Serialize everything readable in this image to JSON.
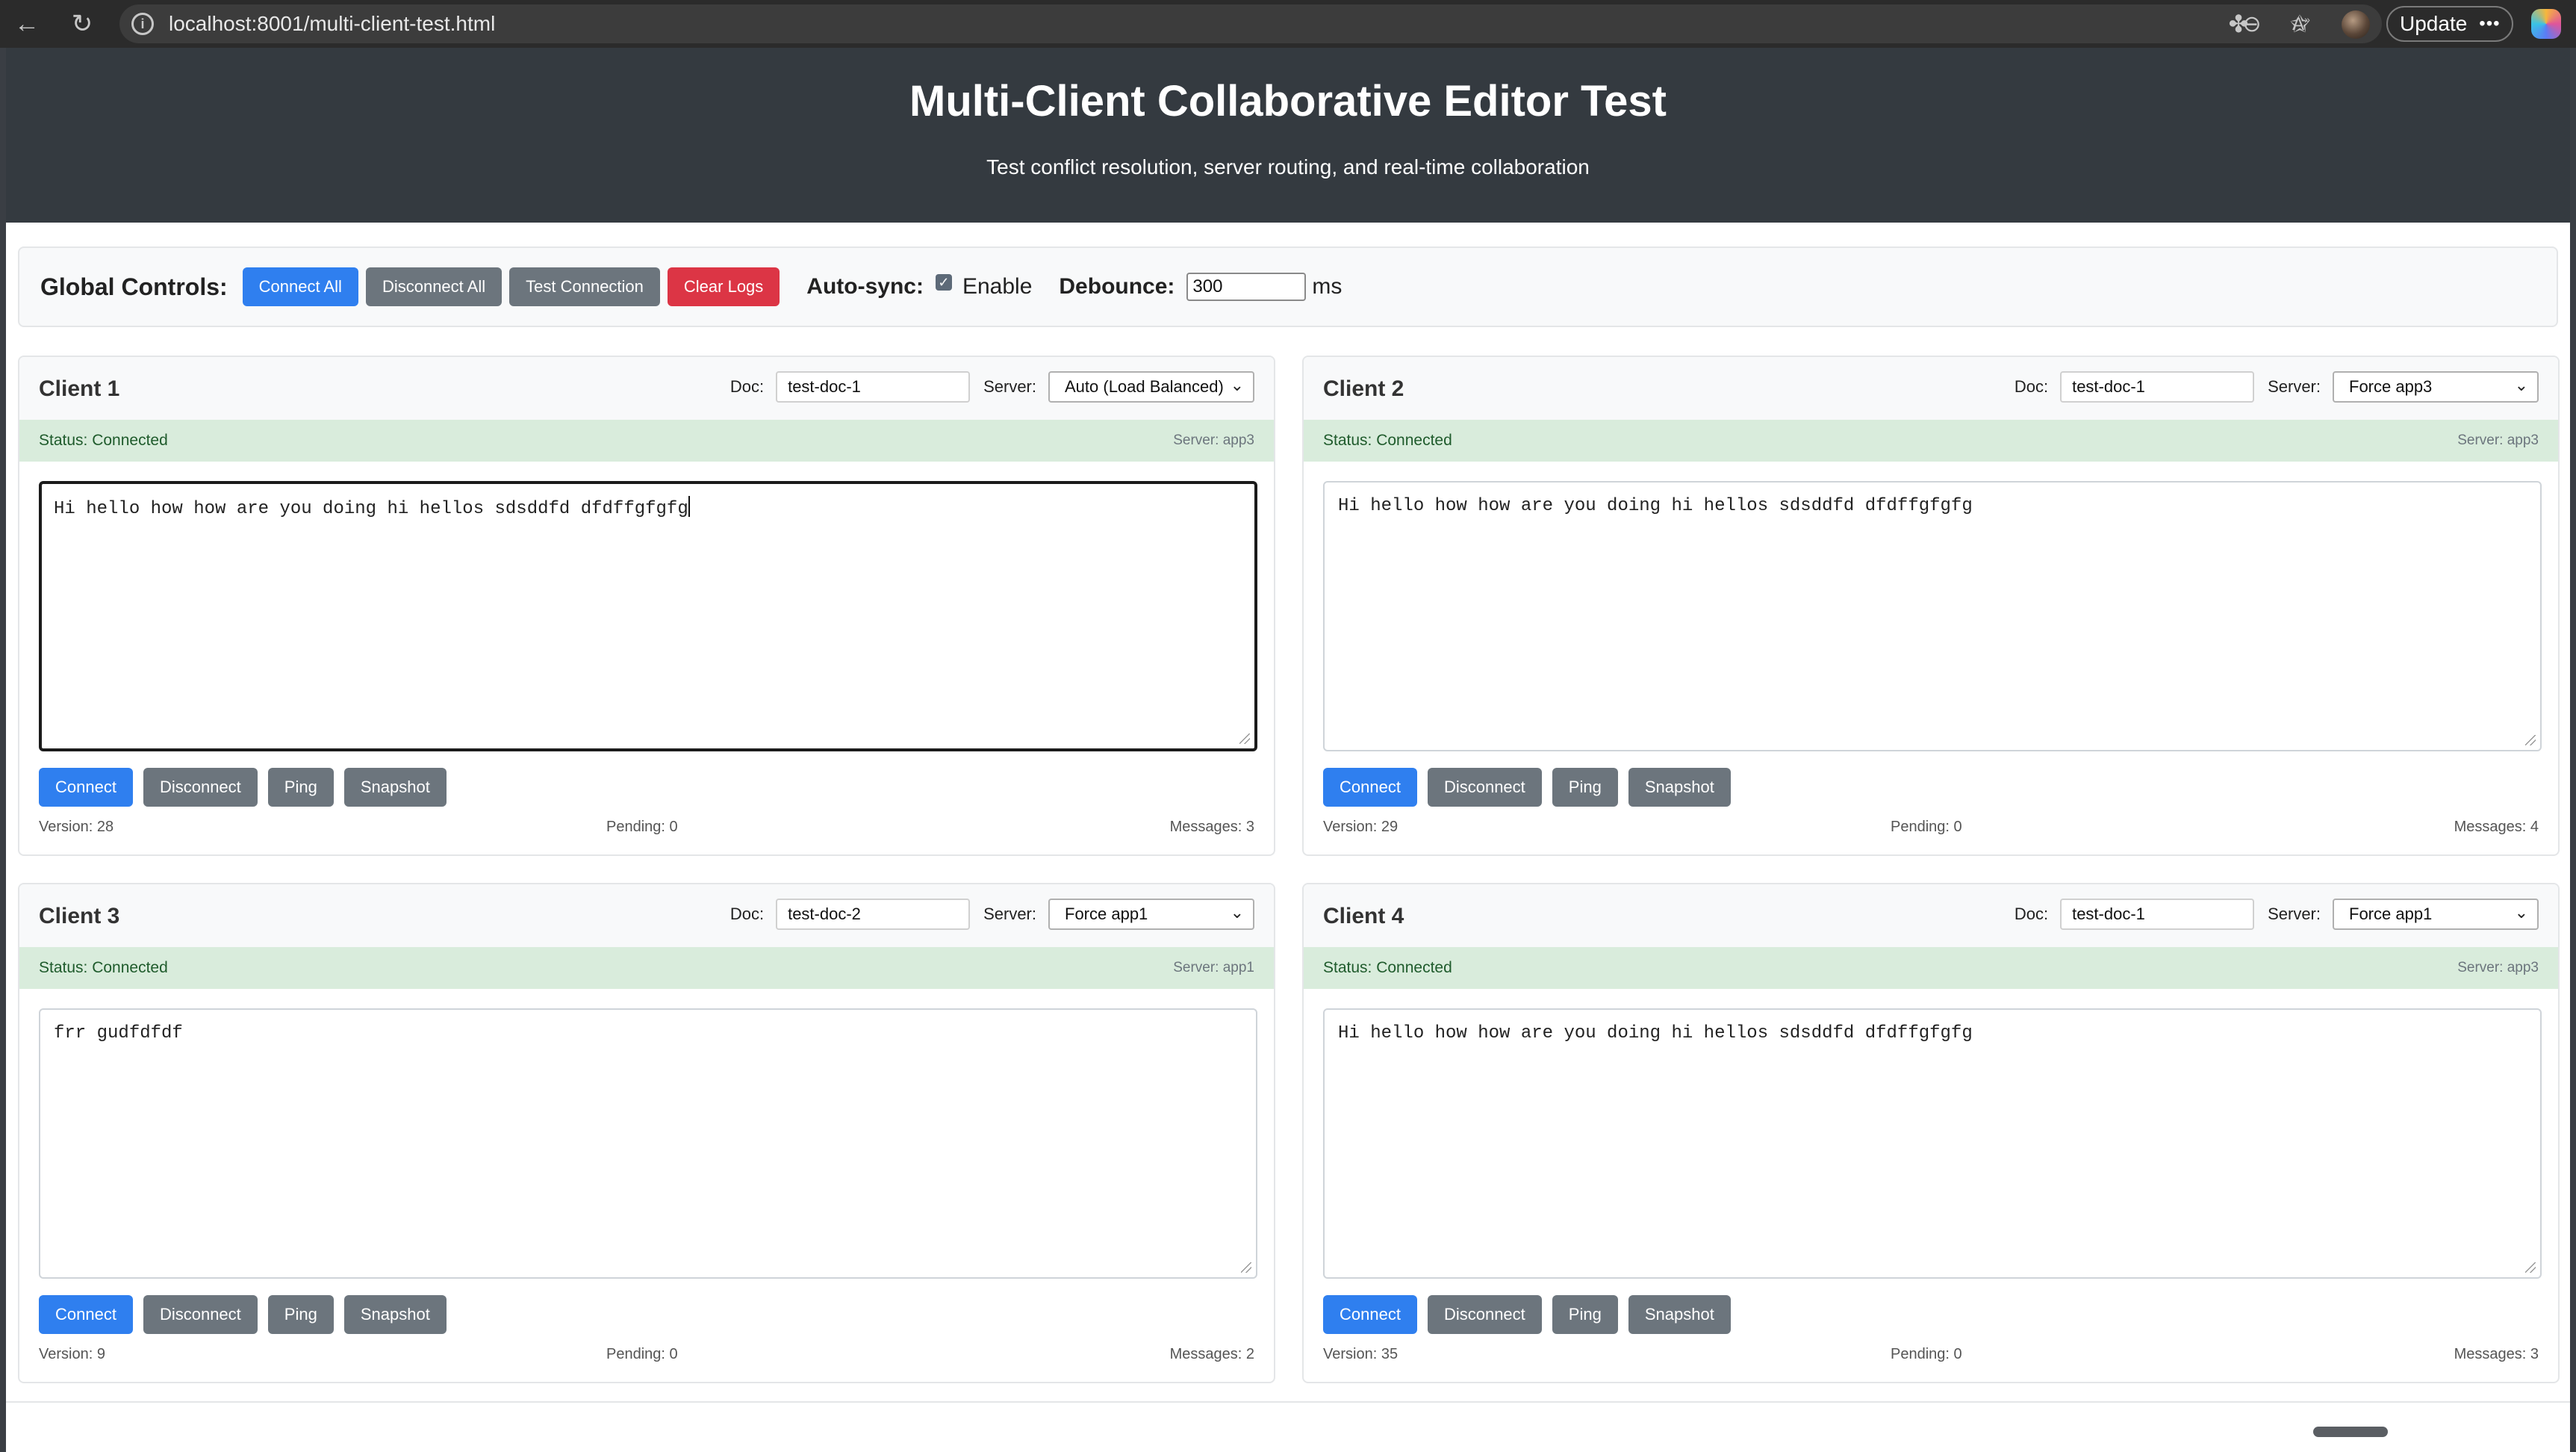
{
  "browser": {
    "back_glyph": "←",
    "reload_glyph": "↻",
    "info_glyph": "i",
    "url": "localhost:8001/multi-client-test.html",
    "url_icons": [
      "zoom-out-icon",
      "read-aloud-icon",
      "favorite-star-icon"
    ],
    "toolbar_icons": [
      "extensions-icon",
      "favorites-icon"
    ],
    "update_label": "Update",
    "menu_glyph": "•••"
  },
  "header": {
    "title": "Multi-Client Collaborative Editor Test",
    "subtitle": "Test conflict resolution, server routing, and real-time collaboration"
  },
  "global_controls": {
    "label": "Global Controls:",
    "connect_all": "Connect All",
    "disconnect_all": "Disconnect All",
    "test_connection": "Test Connection",
    "clear_logs": "Clear Logs",
    "autosync_label": "Auto-sync:",
    "autosync_checked": true,
    "autosync_enable": "Enable",
    "debounce_label": "Debounce:",
    "debounce_value": "300",
    "debounce_unit": "ms"
  },
  "clients": [
    {
      "title": "Client 1",
      "doc_label": "Doc:",
      "doc_value": "test-doc-1",
      "server_label": "Server:",
      "server_value": "Auto (Load Balanced)",
      "status": "Status: Connected",
      "server_info": "Server: app3",
      "content": "Hi hello how how are you doing hi hellos sdsddfd dfdffgfgfg",
      "focused": true,
      "buttons": {
        "connect": "Connect",
        "disconnect": "Disconnect",
        "ping": "Ping",
        "snapshot": "Snapshot"
      },
      "version": "Version: 28",
      "pending": "Pending: 0",
      "messages": "Messages: 3"
    },
    {
      "title": "Client 2",
      "doc_label": "Doc:",
      "doc_value": "test-doc-1",
      "server_label": "Server:",
      "server_value": "Force app3",
      "status": "Status: Connected",
      "server_info": "Server: app3",
      "content": "Hi hello how how are you doing hi hellos sdsddfd dfdffgfgfg",
      "focused": false,
      "buttons": {
        "connect": "Connect",
        "disconnect": "Disconnect",
        "ping": "Ping",
        "snapshot": "Snapshot"
      },
      "version": "Version: 29",
      "pending": "Pending: 0",
      "messages": "Messages: 4"
    },
    {
      "title": "Client 3",
      "doc_label": "Doc:",
      "doc_value": "test-doc-2",
      "server_label": "Server:",
      "server_value": "Force app1",
      "status": "Status: Connected",
      "server_info": "Server: app1",
      "content": "frr gudfdfdf",
      "focused": false,
      "buttons": {
        "connect": "Connect",
        "disconnect": "Disconnect",
        "ping": "Ping",
        "snapshot": "Snapshot"
      },
      "version": "Version: 9",
      "pending": "Pending: 0",
      "messages": "Messages: 2"
    },
    {
      "title": "Client 4",
      "doc_label": "Doc:",
      "doc_value": "test-doc-1",
      "server_label": "Server:",
      "server_value": "Force app1",
      "status": "Status: Connected",
      "server_info": "Server: app3",
      "content": "Hi hello how how are you doing hi hellos sdsddfd dfdffgfgfg",
      "focused": false,
      "buttons": {
        "connect": "Connect",
        "disconnect": "Disconnect",
        "ping": "Ping",
        "snapshot": "Snapshot"
      },
      "version": "Version: 35",
      "pending": "Pending: 0",
      "messages": "Messages: 3"
    }
  ],
  "colors": {
    "primary": "#2f7fef",
    "secondary": "#6c757d",
    "danger": "#dc3545",
    "status_bg": "#d9ecdc",
    "header_bg": "#343a40"
  }
}
